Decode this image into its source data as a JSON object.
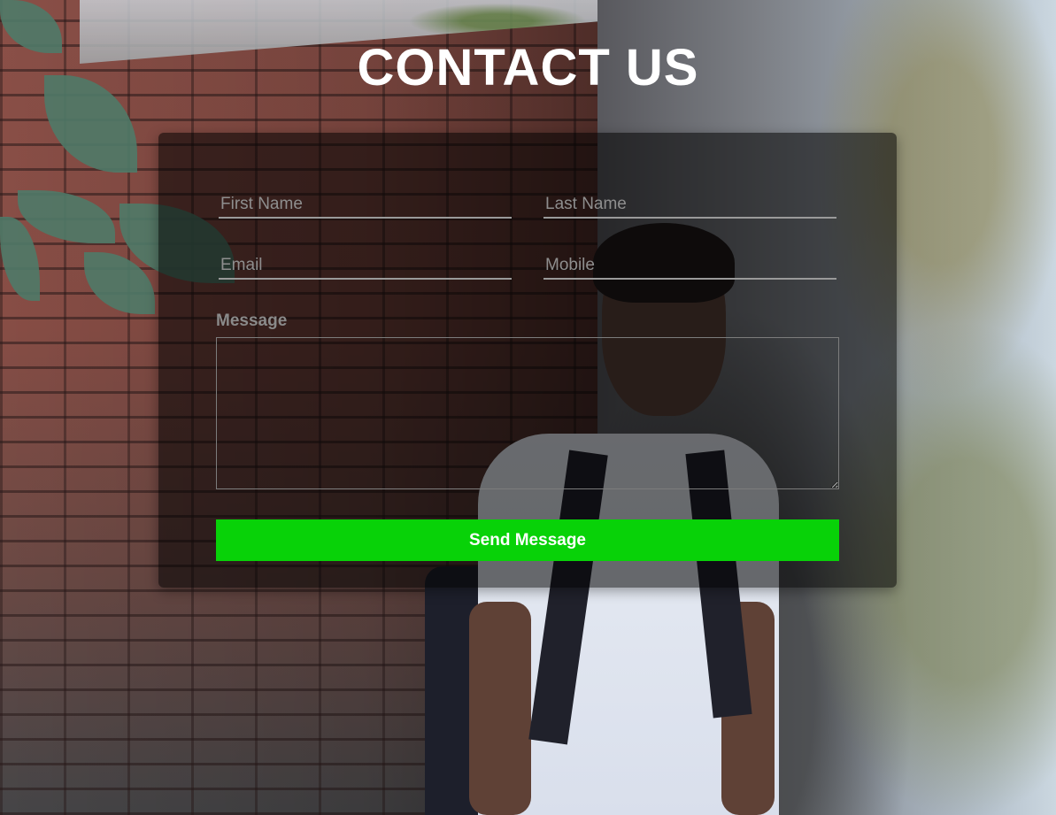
{
  "page": {
    "title": "CONTACT US"
  },
  "form": {
    "first_name": {
      "placeholder": "First Name",
      "value": ""
    },
    "last_name": {
      "placeholder": "Last Name",
      "value": ""
    },
    "email": {
      "placeholder": "Email",
      "value": ""
    },
    "mobile": {
      "placeholder": "Mobile",
      "value": ""
    },
    "message_label": "Message",
    "message_value": "",
    "submit_label": "Send Message"
  },
  "colors": {
    "submit_button": "#08d208",
    "card_overlay": "rgba(0,0,0,0.55)",
    "title_text": "#ffffff"
  }
}
